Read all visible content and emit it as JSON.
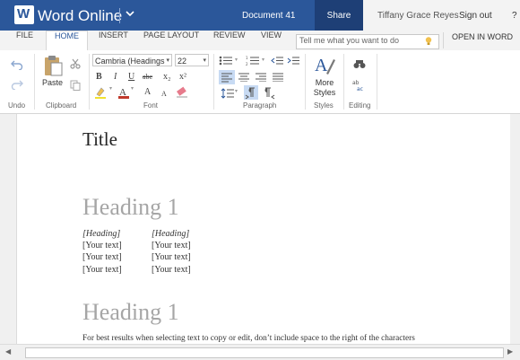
{
  "app": {
    "name": "Word Online",
    "logo_letter": "W",
    "document_name": "Document 41",
    "share_label": "Share",
    "user_name": "Tiffany Grace Reyes",
    "sign_out_label": "Sign out",
    "help_label": "?",
    "brand_color": "#2b579a"
  },
  "ribbon_tabs": [
    "FILE",
    "HOME",
    "INSERT",
    "PAGE LAYOUT",
    "REVIEW",
    "VIEW"
  ],
  "active_tab": "HOME",
  "tell_me": {
    "placeholder": "Tell me what you want to do"
  },
  "open_in_word_label": "OPEN IN WORD",
  "ribbon": {
    "undo_group": "Undo",
    "clipboard_group": "Clipboard",
    "font_group": "Font",
    "paragraph_group": "Paragraph",
    "styles_group": "Styles",
    "editing_group": "Editing",
    "paste_label": "Paste",
    "font_name": "Cambria (Headings",
    "font_size": "22",
    "bold": "B",
    "italic": "I",
    "underline": "U",
    "strikethrough": "abc",
    "subscript": "x₂",
    "superscript": "x²",
    "grow_font": "A",
    "shrink_font": "A",
    "more_styles_line1": "More",
    "more_styles_line2": "Styles"
  },
  "document": {
    "title": "Title",
    "heading1": "Heading 1",
    "heading2": "Heading 1",
    "table": [
      [
        "[Heading]",
        "[Heading]"
      ],
      [
        "[Your text]",
        "[Your text]"
      ],
      [
        "[Your text]",
        "[Your text]"
      ],
      [
        "[Your text]",
        "[Your text]"
      ]
    ],
    "hint": "For best results when selecting text to copy or edit, don’t include space to the right of the characters"
  }
}
